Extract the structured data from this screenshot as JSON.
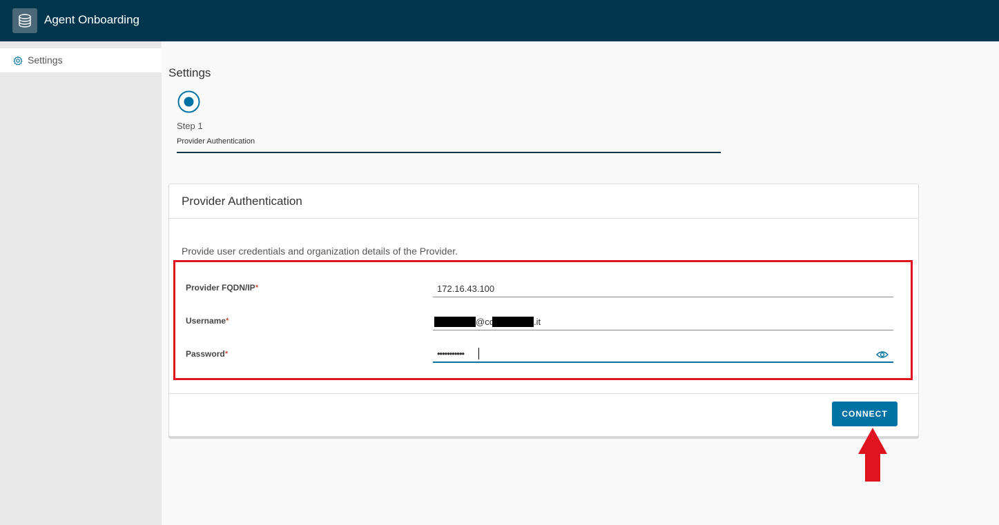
{
  "header": {
    "app_title": "Agent Onboarding",
    "logo_icon": "database-icon"
  },
  "sidebar": {
    "items": [
      {
        "label": "Settings",
        "icon": "gear-icon",
        "active": true
      }
    ]
  },
  "main": {
    "page_title": "Settings",
    "stepper": {
      "step_number": "Step 1",
      "step_name": "Provider Authentication"
    }
  },
  "card": {
    "title": "Provider Authentication",
    "description": "Provide user credentials and organization details of the Provider.",
    "fields": {
      "fqdn": {
        "label": "Provider FQDN/IP",
        "required_mark": "*",
        "value": "172.16.43.100"
      },
      "username": {
        "label": "Username",
        "required_mark": "*",
        "value": "@co",
        "value_suffix": ".it"
      },
      "password": {
        "label": "Password",
        "required_mark": "*",
        "value": "•••••••••••"
      }
    },
    "connect_label": "CONNECT"
  },
  "colors": {
    "header_bg": "#00364d",
    "accent": "#0072a3",
    "highlight": "#e0141e",
    "arrow": "#e0141e"
  }
}
